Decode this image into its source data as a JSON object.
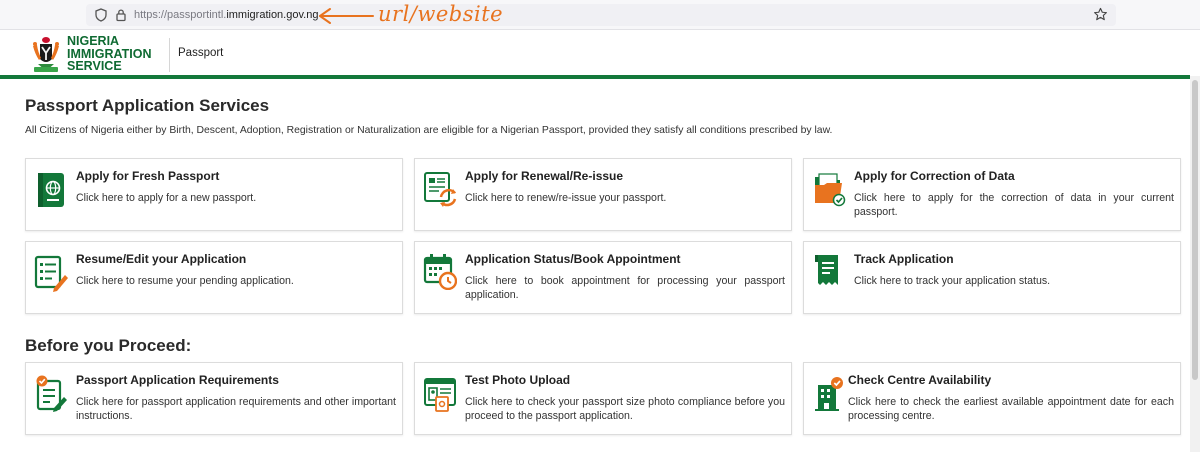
{
  "browser": {
    "url_prefix": "https://passportintl.",
    "url_domain": "immigration.gov.ng",
    "annotation": "url/website",
    "shield_icon": "shield-icon",
    "lock_icon": "lock-icon",
    "star_icon": "bookmark-star-icon"
  },
  "header": {
    "logo_line1": "NIGERIA",
    "logo_line2": "IMMIGRATION",
    "logo_line3": "SERVICE",
    "nav_passport": "Passport"
  },
  "main": {
    "title": "Passport Application Services",
    "description": "All Citizens of Nigeria either by Birth, Descent, Adoption, Registration or Naturalization are eligible for a Nigerian Passport, provided they satisfy all conditions prescribed by law.",
    "cards": [
      {
        "title": "Apply for Fresh Passport",
        "desc": "Click here to apply for a new passport.",
        "icon": "passport-icon"
      },
      {
        "title": "Apply for Renewal/Re-issue",
        "desc": "Click here to renew/re-issue your passport.",
        "icon": "renewal-document-icon"
      },
      {
        "title": "Apply for Correction of Data",
        "desc": "Click here to apply for the correction of data in your current passport.",
        "icon": "folder-check-icon"
      },
      {
        "title": "Resume/Edit your Application",
        "desc": "Click here to resume your pending application.",
        "icon": "edit-form-icon"
      },
      {
        "title": "Application Status/Book Appointment",
        "desc": "Click here to book appointment for processing your passport application.",
        "icon": "calendar-clock-icon"
      },
      {
        "title": "Track Application",
        "desc": "Click here to track your application status.",
        "icon": "receipt-icon"
      }
    ]
  },
  "before": {
    "title": "Before you Proceed:",
    "cards": [
      {
        "title": "Passport Application Requirements",
        "desc": "Click here for passport application requirements and other important instructions.",
        "icon": "checklist-icon"
      },
      {
        "title": "Test Photo Upload",
        "desc": "Click here to check your passport size photo compliance before you proceed to the passport application.",
        "icon": "photo-upload-icon"
      },
      {
        "title": "Check Centre Availability",
        "desc": "Click here to check the earliest available appointment date for each processing centre.",
        "icon": "building-check-icon"
      }
    ]
  },
  "colors": {
    "brand_green": "#13783a",
    "accent_orange": "#e8731f",
    "annotation_orange": "#e8731f"
  }
}
